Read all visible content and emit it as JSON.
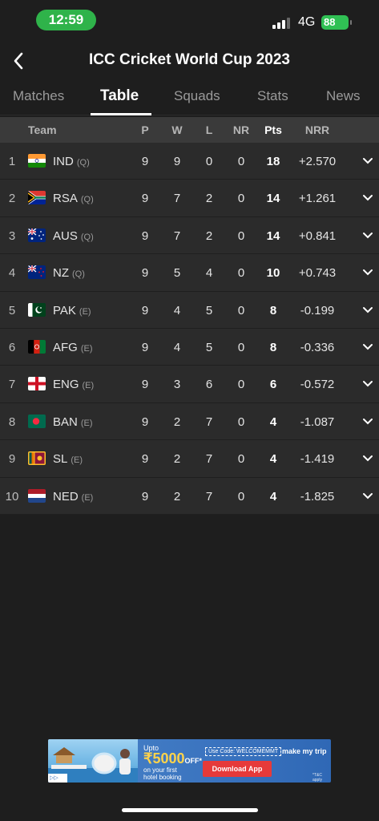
{
  "status_bar": {
    "time": "12:59",
    "network": "4G",
    "battery": "88"
  },
  "header": {
    "title": "ICC Cricket World Cup 2023",
    "back_icon": "chevron-left-icon"
  },
  "tabs": [
    {
      "label": "Matches",
      "active": false
    },
    {
      "label": "Table",
      "active": true
    },
    {
      "label": "Squads",
      "active": false
    },
    {
      "label": "Stats",
      "active": false
    },
    {
      "label": "News",
      "active": false
    }
  ],
  "table": {
    "columns": {
      "team": "Team",
      "p": "P",
      "w": "W",
      "l": "L",
      "nr": "NR",
      "pts": "Pts",
      "nrr": "NRR"
    },
    "rows": [
      {
        "pos": "1",
        "team": "IND",
        "status": "(Q)",
        "p": "9",
        "w": "9",
        "l": "0",
        "nr": "0",
        "pts": "18",
        "nrr": "+2.570",
        "flag": "india-flag"
      },
      {
        "pos": "2",
        "team": "RSA",
        "status": "(Q)",
        "p": "9",
        "w": "7",
        "l": "2",
        "nr": "0",
        "pts": "14",
        "nrr": "+1.261",
        "flag": "south-africa-flag"
      },
      {
        "pos": "3",
        "team": "AUS",
        "status": "(Q)",
        "p": "9",
        "w": "7",
        "l": "2",
        "nr": "0",
        "pts": "14",
        "nrr": "+0.841",
        "flag": "australia-flag"
      },
      {
        "pos": "4",
        "team": "NZ",
        "status": "(Q)",
        "p": "9",
        "w": "5",
        "l": "4",
        "nr": "0",
        "pts": "10",
        "nrr": "+0.743",
        "flag": "new-zealand-flag"
      },
      {
        "pos": "5",
        "team": "PAK",
        "status": "(E)",
        "p": "9",
        "w": "4",
        "l": "5",
        "nr": "0",
        "pts": "8",
        "nrr": "-0.199",
        "flag": "pakistan-flag"
      },
      {
        "pos": "6",
        "team": "AFG",
        "status": "(E)",
        "p": "9",
        "w": "4",
        "l": "5",
        "nr": "0",
        "pts": "8",
        "nrr": "-0.336",
        "flag": "afghanistan-flag"
      },
      {
        "pos": "7",
        "team": "ENG",
        "status": "(E)",
        "p": "9",
        "w": "3",
        "l": "6",
        "nr": "0",
        "pts": "6",
        "nrr": "-0.572",
        "flag": "england-flag"
      },
      {
        "pos": "8",
        "team": "BAN",
        "status": "(E)",
        "p": "9",
        "w": "2",
        "l": "7",
        "nr": "0",
        "pts": "4",
        "nrr": "-1.087",
        "flag": "bangladesh-flag"
      },
      {
        "pos": "9",
        "team": "SL",
        "status": "(E)",
        "p": "9",
        "w": "2",
        "l": "7",
        "nr": "0",
        "pts": "4",
        "nrr": "-1.419",
        "flag": "sri-lanka-flag"
      },
      {
        "pos": "10",
        "team": "NED",
        "status": "(E)",
        "p": "9",
        "w": "2",
        "l": "7",
        "nr": "0",
        "pts": "4",
        "nrr": "-1.825",
        "flag": "netherlands-flag"
      }
    ]
  },
  "ad": {
    "upto": "Upto",
    "amount": "₹5000",
    "off": "OFF*",
    "subtitle_1": "on your first",
    "subtitle_2": "hotel booking",
    "code": "Use Code: WELCOMEMMT",
    "button": "Download App",
    "brand": "make my trip",
    "tc": "*T&C apply"
  },
  "colors": {
    "background": "#1e1e1e",
    "row": "#2b2b2b",
    "header_row": "#3a3a3a",
    "time_pill": "#2fb34a",
    "battery": "#30c054"
  }
}
